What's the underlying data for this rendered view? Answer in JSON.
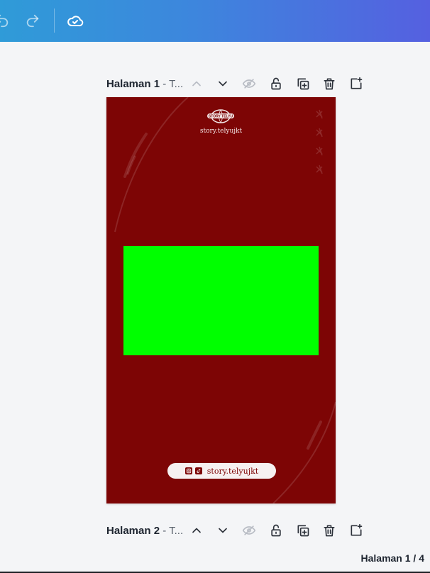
{
  "topbar": {
    "icons": [
      "undo-icon",
      "redo-icon",
      "cloud-saved-icon"
    ],
    "gradient": [
      "#2f9bd8",
      "#5560e0"
    ]
  },
  "pages": [
    {
      "label_bold": "Halaman 1",
      "label_rest": " - T...",
      "actions": [
        "chevron-up-icon",
        "chevron-down-icon",
        "hide-icon",
        "lock-icon",
        "duplicate-icon",
        "trash-icon",
        "add-page-icon"
      ]
    },
    {
      "label_bold": "Halaman 2",
      "label_rest": " - T...",
      "actions": [
        "chevron-up-icon",
        "chevron-down-icon",
        "hide-icon",
        "lock-icon",
        "duplicate-icon",
        "trash-icon",
        "add-page-icon"
      ]
    }
  ],
  "canvas": {
    "background": "#7d0505",
    "logo_text": "STORY TELYU",
    "handle_top": "story.telyujkt",
    "placeholder_color": "#00ff00",
    "footer_handle": "story.telyujkt"
  },
  "page_count": "Halaman 1 / 4"
}
